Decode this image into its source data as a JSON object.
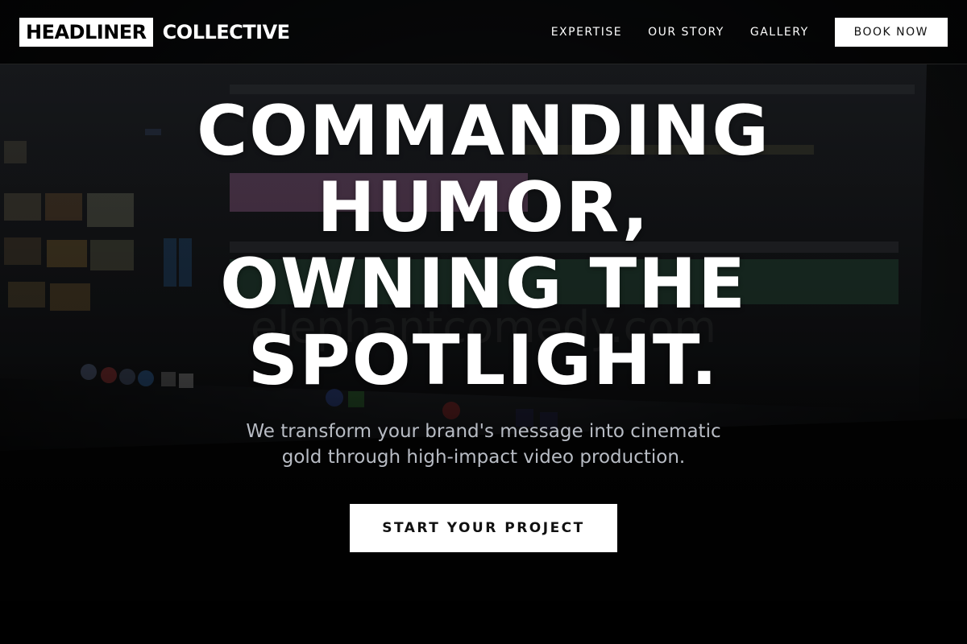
{
  "brand": {
    "logo_box": "HEADLINER",
    "logo_rest": "COLLECTIVE"
  },
  "nav": {
    "links": [
      "EXPERTISE",
      "OUR STORY",
      "GALLERY"
    ],
    "cta": "BOOK NOW"
  },
  "hero": {
    "headline_lines": [
      "COMMANDING",
      "HUMOR,",
      "OWNING THE",
      "SPOTLIGHT."
    ],
    "subhead": "We transform your brand's message into cinematic gold through high-impact video production.",
    "cta": "START YOUR PROJECT",
    "background_image": "video-editing-timeline-monitor"
  },
  "colors": {
    "accent": "#ffffff",
    "text_primary": "#ffffff",
    "text_secondary": "#b8bcc4",
    "background": "#0b0b0b"
  }
}
